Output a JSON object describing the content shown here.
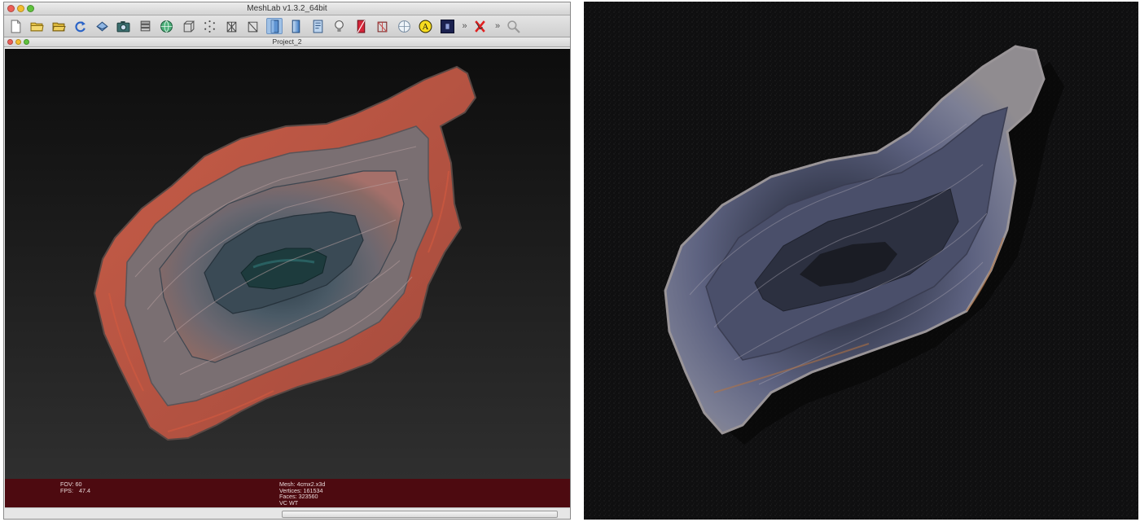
{
  "window": {
    "title": "MeshLab v1.3.2_64bit",
    "document_title": "Project_2"
  },
  "toolbar": {
    "icons": [
      "new-file-icon",
      "open-folder-icon",
      "open-folder-alt-icon",
      "reload-icon",
      "import-mesh-icon",
      "snapshot-icon",
      "layers-icon",
      "globe-icon",
      "bounding-box-icon",
      "points-icon",
      "wireframe-icon",
      "hidden-lines-icon",
      "flat-shading-icon",
      "smooth-shading-icon",
      "texture-icon",
      "light-icon",
      "color-icon",
      "edit-icon",
      "sphere-icon",
      "annotation-icon",
      "plugin-icon",
      "more-icon",
      "select-icon",
      "more-icon-2",
      "search-icon"
    ],
    "annotation_letter": "A"
  },
  "viewport": {
    "fov_label": "FOV:",
    "fov_value": "60",
    "fps_label": "FPS:",
    "fps_value": "47.4",
    "mesh_line": "Mesh: 4cmx2.x3d",
    "vertices_line": "Vertices: 161534",
    "faces_line": "Faces: 323560",
    "vc_line": "VC WT"
  },
  "status": {
    "progress": 0.0
  }
}
